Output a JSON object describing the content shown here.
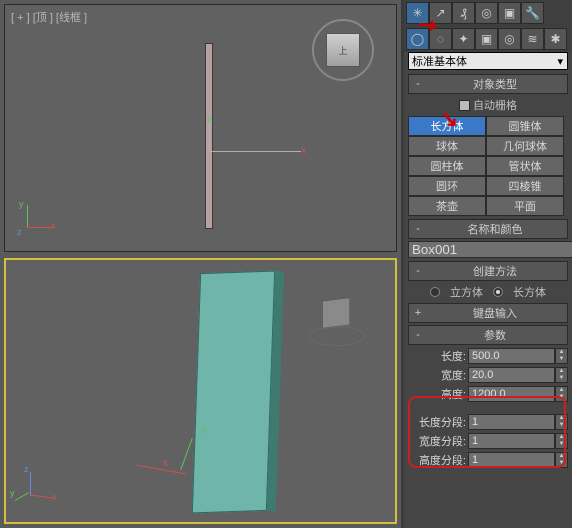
{
  "viewport": {
    "top_label": "[ + ] [顶 ] [线框 ]",
    "persp_label": "",
    "viewcube_face": "上"
  },
  "dropdown": "标准基本体",
  "rollouts": {
    "object_type": "对象类型",
    "auto_grid": "自动栅格",
    "name_color": "名称和颜色",
    "creation_method": "创建方法",
    "keyboard_entry": "键盘输入",
    "parameters": "参数"
  },
  "primitives": [
    "长方体",
    "圆锥体",
    "球体",
    "几何球体",
    "圆柱体",
    "管状体",
    "圆环",
    "四棱锥",
    "茶壶",
    "平面"
  ],
  "selected_primitive_index": 0,
  "object_name": "Box001",
  "creation_method": {
    "opt_cube": "立方体",
    "opt_box": "长方体"
  },
  "params": {
    "length_label": "长度:",
    "width_label": "宽度:",
    "height_label": "高度:",
    "length": "500.0",
    "width": "20.0",
    "height": "1200.0"
  },
  "segments": {
    "length_segs_label": "长度分段:",
    "width_segs_label": "宽度分段:",
    "height_segs_label": "高度分段:",
    "length_segs": "1",
    "width_segs": "1",
    "height_segs": "1"
  },
  "axes": {
    "x": "x",
    "y": "y",
    "z": "z"
  }
}
